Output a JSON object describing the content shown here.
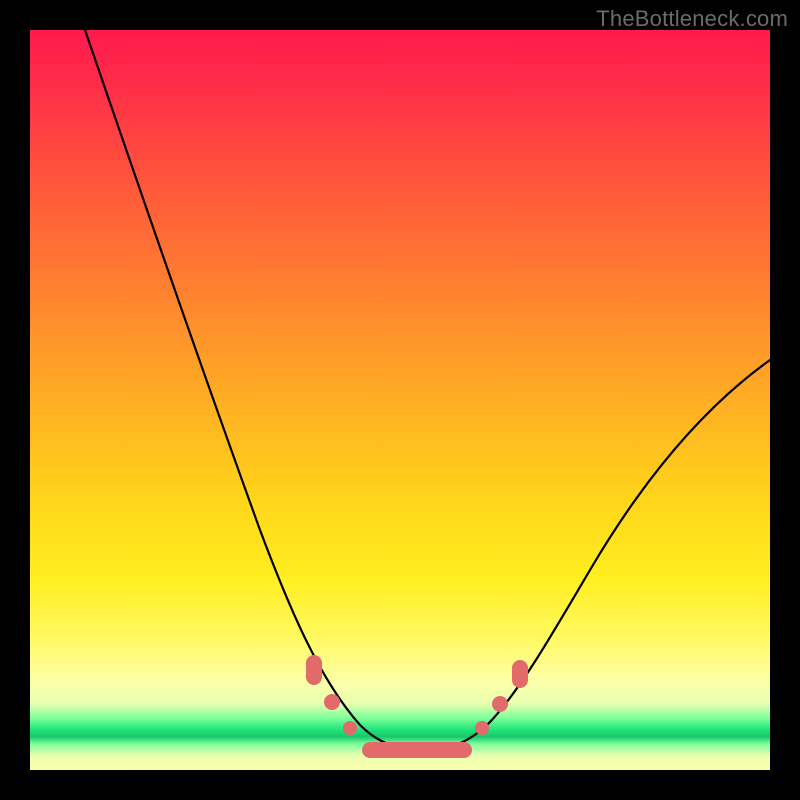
{
  "watermark": "TheBottleneck.com",
  "chart_data": {
    "type": "line",
    "title": "",
    "xlabel": "",
    "ylabel": "",
    "xlim": [
      0,
      100
    ],
    "ylim": [
      0,
      100
    ],
    "grid": false,
    "legend": false,
    "series": [
      {
        "name": "curve",
        "x": [
          10,
          14,
          18,
          22,
          26,
          30,
          34,
          38,
          42,
          44,
          46,
          48,
          50,
          52,
          54,
          56,
          58,
          60,
          64,
          70,
          78,
          86,
          94,
          100
        ],
        "y": [
          100,
          87,
          74,
          62,
          50,
          39,
          29,
          20,
          12,
          9,
          7,
          6,
          5.5,
          5.5,
          6,
          7,
          9,
          12,
          18,
          26,
          36,
          45,
          52,
          57
        ]
      }
    ],
    "markers": [
      {
        "x": 38.5,
        "y": 13.5,
        "shape": "round-cap"
      },
      {
        "x": 40.0,
        "y": 10.0,
        "shape": "dot"
      },
      {
        "x": 43.0,
        "y": 7.0,
        "shape": "dot"
      },
      {
        "x": 46.0,
        "y": 5.5,
        "shape": "bar-start"
      },
      {
        "x": 54.0,
        "y": 5.5,
        "shape": "bar-end"
      },
      {
        "x": 57.0,
        "y": 7.0,
        "shape": "dot"
      },
      {
        "x": 59.5,
        "y": 10.0,
        "shape": "dot"
      },
      {
        "x": 62.0,
        "y": 14.0,
        "shape": "round-cap"
      }
    ],
    "background_gradient": {
      "top": "#ff1a4d",
      "mid": "#ffd61a",
      "band": "#18c76b",
      "bottom": "#fdffa8"
    }
  }
}
